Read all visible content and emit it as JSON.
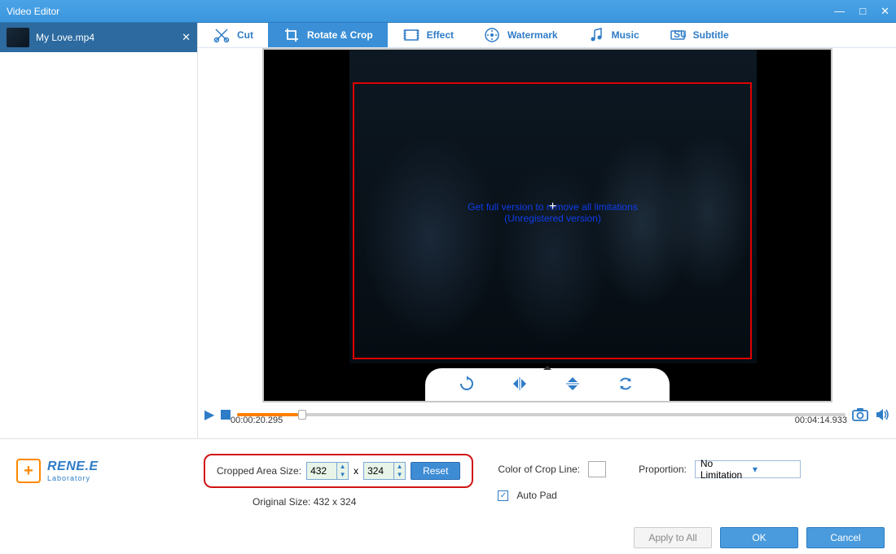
{
  "window": {
    "title": "Video Editor"
  },
  "file": {
    "name": "My Love.mp4"
  },
  "tabs": {
    "cut": "Cut",
    "rotate": "Rotate & Crop",
    "effect": "Effect",
    "watermark": "Watermark",
    "music": "Music",
    "subtitle": "Subtitle",
    "active": "rotate"
  },
  "overlay": {
    "line1": "Get full version to remove all limitations",
    "line2": "(Unregistered version)"
  },
  "playback": {
    "current": "00:00:20.295",
    "total": "00:04:14.933",
    "progress_pct": 8
  },
  "crop": {
    "label": "Cropped Area Size:",
    "w": "432",
    "h": "324",
    "sep": "x",
    "reset": "Reset",
    "orig_label": "Original Size: 432 x 324",
    "color_label": "Color of Crop Line:",
    "color": "#ffffff",
    "prop_label": "Proportion:",
    "prop_value": "No Limitation",
    "autopad_label": "Auto Pad",
    "autopad_checked": true
  },
  "logo": {
    "brand": "RENE.E",
    "sub": "Laboratory"
  },
  "buttons": {
    "apply_all": "Apply to All",
    "ok": "OK",
    "cancel": "Cancel"
  }
}
